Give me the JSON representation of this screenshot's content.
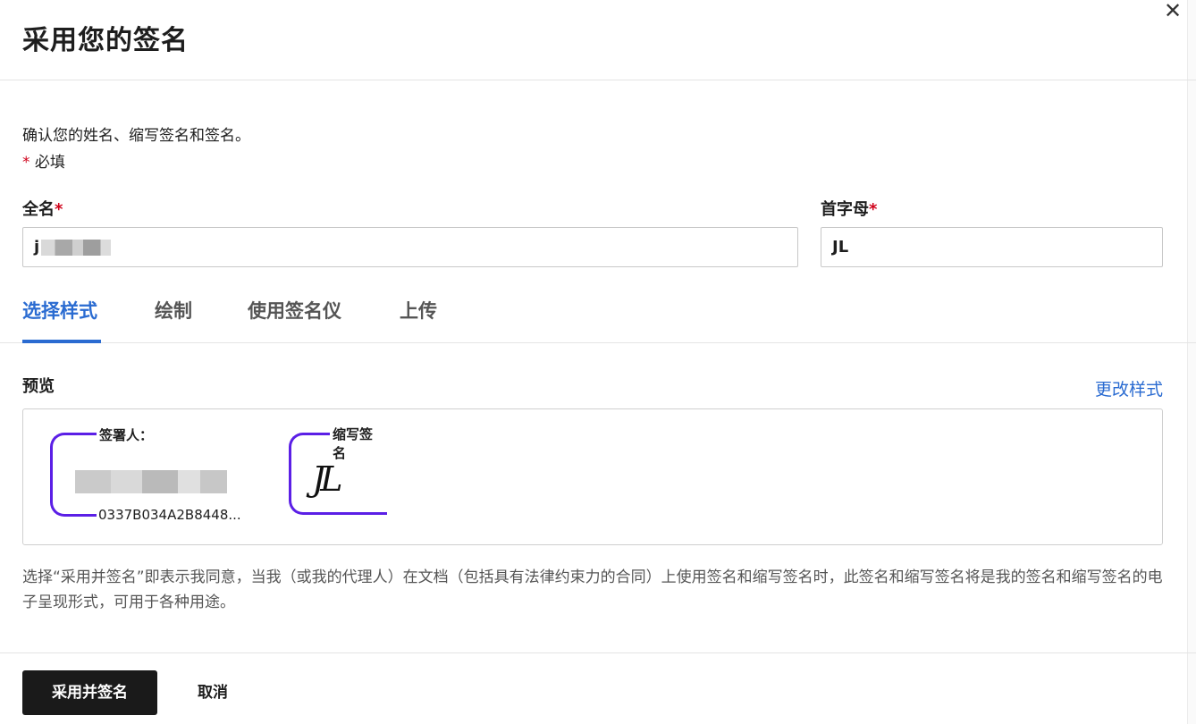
{
  "dialog": {
    "title": "采用您的签名",
    "close_symbol": "✕",
    "intro": "确认您的姓名、缩写签名和签名。",
    "required_star": "*",
    "required_label": " 必填"
  },
  "form": {
    "fullname_label": "全名",
    "fullname_star": "*",
    "fullname_value_visible": "j",
    "initials_label": "首字母",
    "initials_star": "*",
    "initials_value": "JL"
  },
  "tabs": [
    {
      "label": "选择样式",
      "active": true
    },
    {
      "label": "绘制",
      "active": false
    },
    {
      "label": "使用签名仪",
      "active": false
    },
    {
      "label": "上传",
      "active": false
    }
  ],
  "preview": {
    "label": "预览",
    "change_style": "更改样式",
    "signature_caption": "签署人：",
    "signature_hash": "0337B034A2B8448...",
    "initials_caption": "缩写签名",
    "initials_script": "JL"
  },
  "disclaimer": "选择“采用并签名”即表示我同意，当我（或我的代理人）在文档（包括具有法律约束力的合同）上使用签名和缩写签名时，此签名和缩写签名将是我的签名和缩写签名的电子呈现形式，可用于各种用途。",
  "footer": {
    "adopt_button": "采用并签名",
    "cancel_button": "取消"
  },
  "colors": {
    "accent": "#2a6bd1",
    "signature_bracket": "#5b1fe6",
    "required": "#d0021b",
    "primary_button": "#1a1a1a"
  }
}
